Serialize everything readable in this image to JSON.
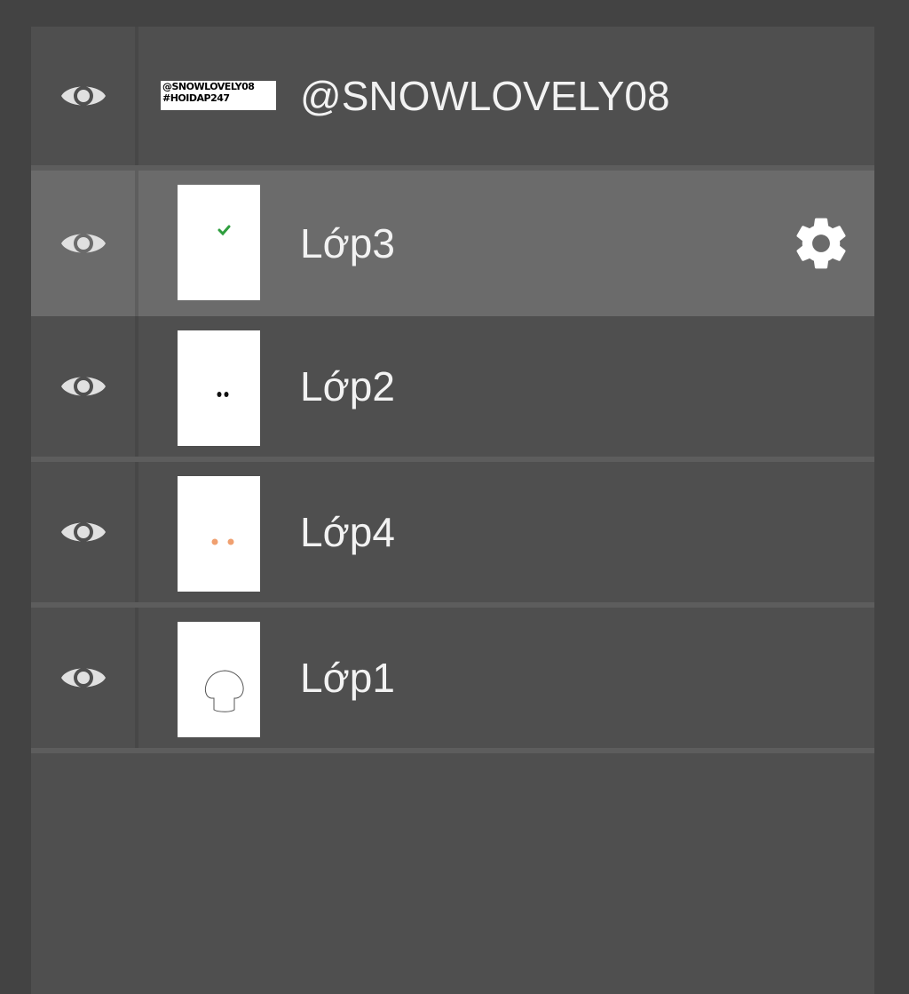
{
  "layers_panel": {
    "layers": [
      {
        "name": "@SNOWLOVELY08",
        "thumbnail_type": "watermark",
        "thumbnail_text": [
          "@SNOWLOVELY08",
          "#HOIDAP247"
        ],
        "visible": true,
        "selected": false
      },
      {
        "name": "Lớp3",
        "thumbnail_type": "green-mark",
        "visible": true,
        "selected": true
      },
      {
        "name": "Lớp2",
        "thumbnail_type": "black-eyes",
        "visible": true,
        "selected": false
      },
      {
        "name": "Lớp4",
        "thumbnail_type": "orange-cheeks",
        "visible": true,
        "selected": false
      },
      {
        "name": "Lớp1",
        "thumbnail_type": "mushroom-outline",
        "visible": true,
        "selected": false
      }
    ],
    "icons": {
      "visibility": "eye-icon",
      "settings": "gear-icon"
    },
    "colors": {
      "background": "#434343",
      "panel": "#4f4f4f",
      "selected_row": "#6b6b6b",
      "separator": "#5d5d5d",
      "text": "#f2f2f2",
      "eye_icon": "#e0e0e0",
      "thumb_green": "#2e9e3e",
      "thumb_orange": "#f0a070"
    }
  }
}
